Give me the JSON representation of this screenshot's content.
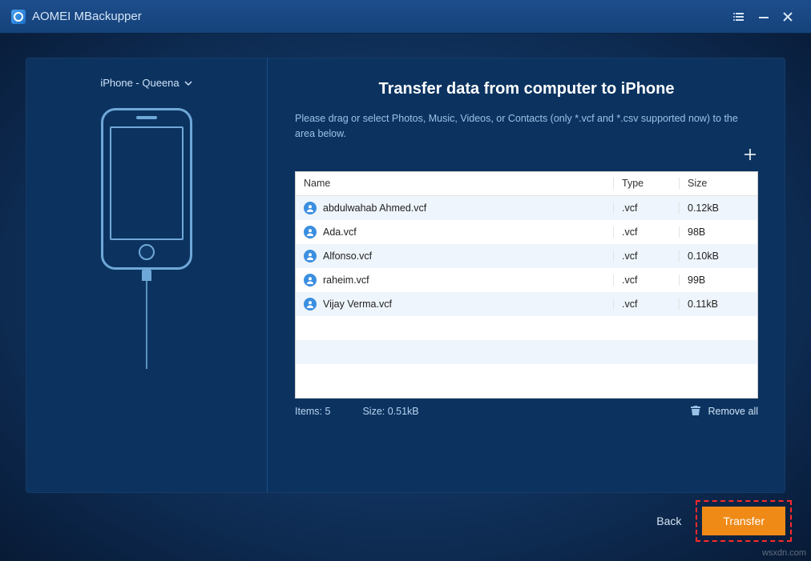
{
  "title": "AOMEI MBackupper",
  "device": {
    "label": "iPhone - Queena"
  },
  "main": {
    "heading": "Transfer data from computer to iPhone",
    "subtext": "Please drag or select Photos, Music, Videos, or Contacts (only *.vcf and *.csv supported now) to the area below."
  },
  "table": {
    "headers": {
      "name": "Name",
      "type": "Type",
      "size": "Size"
    },
    "rows": [
      {
        "name": "abdulwahab Ahmed.vcf",
        "type": ".vcf",
        "size": "0.12kB"
      },
      {
        "name": "Ada.vcf",
        "type": ".vcf",
        "size": "98B"
      },
      {
        "name": "Alfonso.vcf",
        "type": ".vcf",
        "size": "0.10kB"
      },
      {
        "name": "raheim.vcf",
        "type": ".vcf",
        "size": "99B"
      },
      {
        "name": "Vijay Verma.vcf",
        "type": ".vcf",
        "size": "0.11kB"
      }
    ]
  },
  "status": {
    "items_label": "Items: 5",
    "size_label": "Size: 0.51kB",
    "remove_all": "Remove all"
  },
  "footer": {
    "back": "Back",
    "transfer": "Transfer"
  },
  "watermark": "wsxdn.com"
}
